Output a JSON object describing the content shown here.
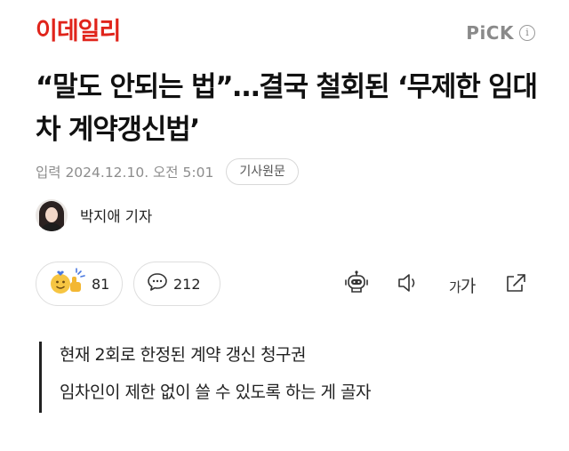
{
  "header": {
    "logo": "이데일리",
    "pick_label": "PiCK",
    "info_glyph": "i"
  },
  "article": {
    "title": "“말도 안되는 법”…결국 철회된 ‘무제한 임대차 계약갱신법’",
    "date": "입력 2024.12.10. 오전 5:01",
    "original_button": "기사원문",
    "reporter": "박지애 기자"
  },
  "actions": {
    "like_count": "81",
    "comment_count": "212",
    "font_small": "가",
    "font_big": "가"
  },
  "summary": {
    "lines": [
      "현재 2회로 한정된 계약 갱신 청구권",
      "임차인이 제한 없이 쓸 수 있도록 하는 게 골자"
    ]
  },
  "colors": {
    "brand": "#e0241b",
    "muted": "#8d8d8d",
    "reaction_emoji": "#f6c542"
  }
}
